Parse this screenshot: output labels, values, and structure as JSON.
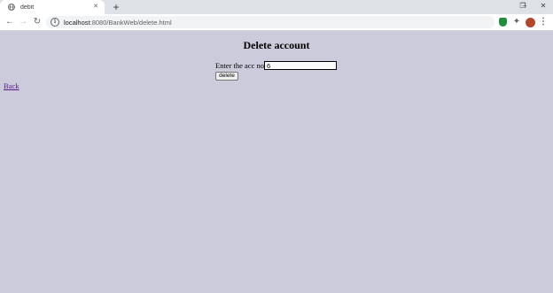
{
  "browser": {
    "tab": {
      "title": "debit"
    },
    "url": {
      "host": "localhost",
      "path": ":8080/BankWeb/delete.html"
    },
    "icons": {
      "tab": "globe-icon",
      "close": "close-icon",
      "new_tab": "plus-icon",
      "back": "arrow-left-icon",
      "forward": "arrow-right-icon",
      "reload": "reload-icon",
      "info": "info-icon",
      "bookmark": "star-icon",
      "extension_1": "shield-icon",
      "extension_2": "puzzle-icon",
      "profile": "avatar-icon",
      "menu": "kebab-menu-icon",
      "minimize": "minimize-icon",
      "restore": "restore-icon",
      "window_close": "window-close-icon"
    }
  },
  "page": {
    "title": "Delete account",
    "form": {
      "label": "Enter the acc no.",
      "account_value": "6",
      "submit_label": "delete"
    },
    "back_link": "Back"
  },
  "colors": {
    "page_background": "#cccbdb",
    "visited_link": "#551a8b"
  }
}
